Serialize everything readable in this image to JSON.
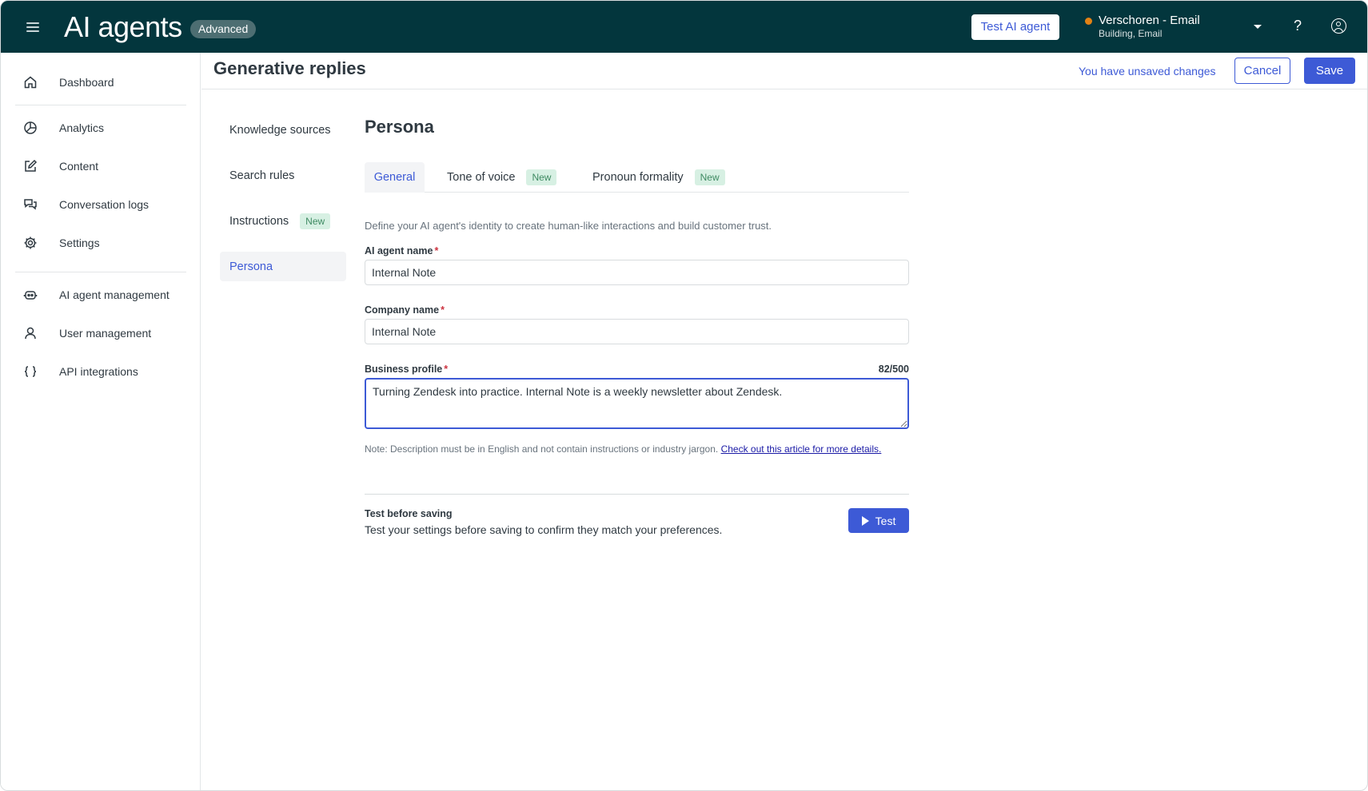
{
  "header": {
    "app_title": "AI agents",
    "plan_badge": "Advanced",
    "test_agent_label": "Test AI agent",
    "brand_name": "Verschoren - Email",
    "brand_sub": "Building, Email",
    "help_glyph": "?"
  },
  "sidebar": {
    "items": [
      {
        "label": "Dashboard",
        "icon": "home-icon"
      },
      {
        "label": "Analytics",
        "icon": "pie-chart-icon"
      },
      {
        "label": "Content",
        "icon": "edit-icon"
      },
      {
        "label": "Conversation logs",
        "icon": "chat-icon"
      },
      {
        "label": "Settings",
        "icon": "gear-icon"
      },
      {
        "label": "AI agent management",
        "icon": "robot-icon"
      },
      {
        "label": "User management",
        "icon": "user-icon"
      },
      {
        "label": "API integrations",
        "icon": "braces-icon"
      }
    ]
  },
  "page": {
    "title": "Generative replies",
    "unsaved": "You have unsaved changes",
    "cancel_label": "Cancel",
    "save_label": "Save"
  },
  "subnav": {
    "items": [
      {
        "label": "Knowledge sources"
      },
      {
        "label": "Search rules"
      },
      {
        "label": "Instructions",
        "badge": "New"
      },
      {
        "label": "Persona",
        "active": true
      }
    ]
  },
  "persona": {
    "title": "Persona",
    "tabs": [
      {
        "label": "General",
        "active": true
      },
      {
        "label": "Tone of voice",
        "badge": "New"
      },
      {
        "label": "Pronoun formality",
        "badge": "New"
      }
    ],
    "intro": "Define your AI agent's identity to create human-like interactions and build customer trust.",
    "agent_name_label": "AI agent name",
    "agent_name_value": "Internal Note",
    "company_name_label": "Company name",
    "company_name_value": "Internal Note",
    "business_profile_label": "Business profile",
    "business_profile_counter": "82/500",
    "business_profile_value": "Turning Zendesk into practice. Internal Note is a weekly newsletter about Zendesk.",
    "required_mark": "*",
    "note_text": "Note: Description must be in English and not contain instructions or industry jargon. ",
    "note_link": "Check out this article for more details.",
    "test_title": "Test before saving",
    "test_desc": "Test your settings before saving to confirm they match your preferences.",
    "test_button": "Test"
  },
  "colors": {
    "topbar": "#03363d",
    "accent": "#3d5ad6",
    "new_badge_bg": "#d7f0e3",
    "new_badge_text": "#3e8a62",
    "status_dot": "#e38215",
    "required": "#cc3340"
  }
}
